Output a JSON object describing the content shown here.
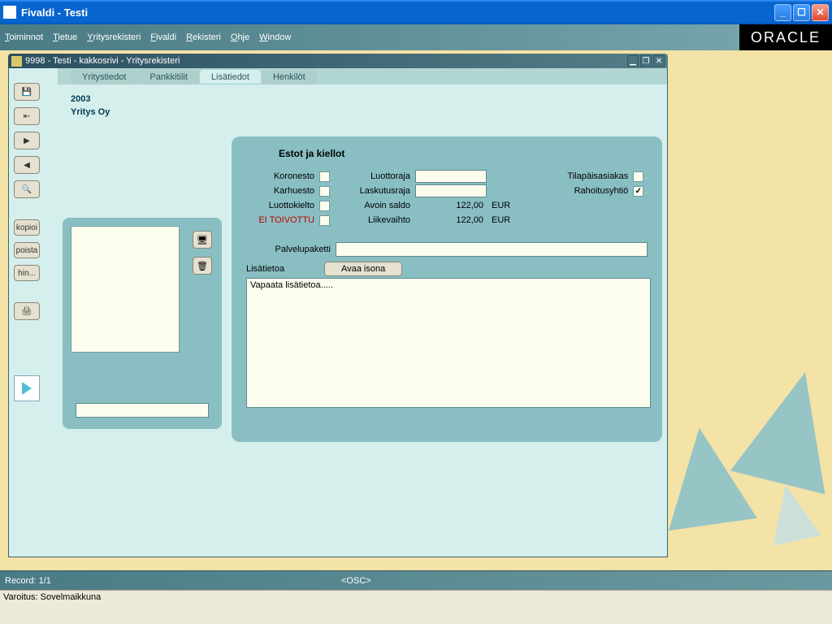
{
  "window": {
    "title": "Fivaldi - Testi"
  },
  "menu": {
    "items": [
      "Toiminnot",
      "Tietue",
      "Yritysrekisteri",
      "Fivaldi",
      "Rekisteri",
      "Ohje",
      "Window"
    ],
    "brand": "ORACLE"
  },
  "mdi": {
    "title": "9998 - Testi - kakkosrivi - Yritysrekisteri"
  },
  "toolbar": {
    "kopioi": "kopioi",
    "poista": "poista",
    "hin": "hin..."
  },
  "tabs": {
    "t1": "Yritystiedot",
    "t2": "Pankkitilit",
    "t3": "Lisätiedot",
    "t4": "Henkilöt"
  },
  "header": {
    "year": "2003",
    "company": "Yritys Oy"
  },
  "panel": {
    "title": "Estot ja kiellot",
    "koronesto": "Koronesto",
    "karhuesto": "Karhuesto",
    "luottokielto": "Luottokielto",
    "eitoivottu": "EI TOIVOTTU",
    "luottoraja": "Luottoraja",
    "laskutusraja": "Laskutusraja",
    "avoinsaldo": "Avoin saldo",
    "avoinsaldo_val": "122,00",
    "avoinsaldo_cur": "EUR",
    "liikevaihto": "Liikevaihto",
    "liikevaihto_val": "122,00",
    "liikevaihto_cur": "EUR",
    "tilapais": "Tilapäisasiakas",
    "rahoitus": "Rahoitusyhtiö",
    "palvelupaketti": "Palvelupaketti",
    "lisatietoa": "Lisätietoa",
    "avaaisona": "Avaa isona",
    "freetext": "Vapaata lisätietoa....."
  },
  "status": {
    "record": "Record: 1/1",
    "osc": "<OSC>"
  },
  "footer": {
    "msg": "Varoitus: Sovelmaikkuna"
  }
}
